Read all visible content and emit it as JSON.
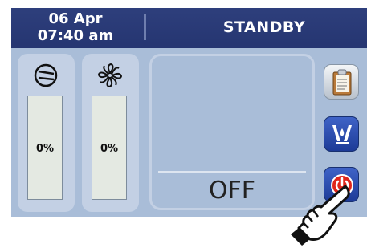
{
  "header": {
    "date": "06 Apr",
    "time": "07:40 am",
    "status": "STANDBY"
  },
  "gauges": [
    {
      "icon": "compressor-icon",
      "percent_label": "0%",
      "level": 0
    },
    {
      "icon": "fan-icon",
      "percent_label": "0%",
      "level": 0
    }
  ],
  "panel": {
    "state": "OFF"
  },
  "side_buttons": [
    {
      "icon": "clipboard-icon"
    },
    {
      "icon": "valve-icon"
    },
    {
      "icon": "power-icon",
      "color": "#e0261b"
    }
  ],
  "colors": {
    "header": "#2b3b78",
    "background": "#a9bdd8",
    "button_blue": "#2a4fb8",
    "power_red": "#e0261b"
  }
}
